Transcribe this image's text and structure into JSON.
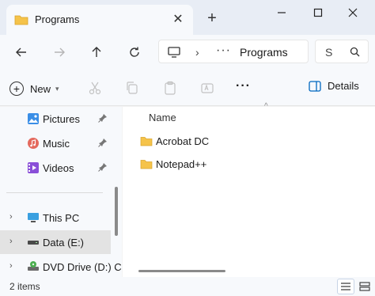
{
  "window": {
    "tab_title": "Programs",
    "new_tab_symbol": "+",
    "close_tab_symbol": "✕"
  },
  "address_bar": {
    "ellipsis": "···",
    "crumb": "Programs",
    "search_text": "S"
  },
  "command_bar": {
    "new_label": "New",
    "more_symbol": "···",
    "details_label": "Details"
  },
  "sidebar": {
    "quick_access": [
      {
        "label": "Pictures",
        "icon": "pictures-icon"
      },
      {
        "label": "Music",
        "icon": "music-icon"
      },
      {
        "label": "Videos",
        "icon": "videos-icon"
      }
    ],
    "locations": [
      {
        "label": "This PC",
        "icon": "pc-icon"
      },
      {
        "label": "Data (E:)",
        "icon": "drive-icon",
        "selected": true
      },
      {
        "label": "DVD Drive (D:) C",
        "icon": "dvd-drive-icon"
      }
    ]
  },
  "content": {
    "column_header": "Name",
    "items": [
      {
        "name": "Acrobat DC",
        "icon": "folder-icon"
      },
      {
        "name": "Notepad++",
        "icon": "folder-icon"
      }
    ]
  },
  "status_bar": {
    "item_count": "2 items"
  },
  "colors": {
    "folder": "#f5c34a",
    "accent": "#0067c0"
  }
}
